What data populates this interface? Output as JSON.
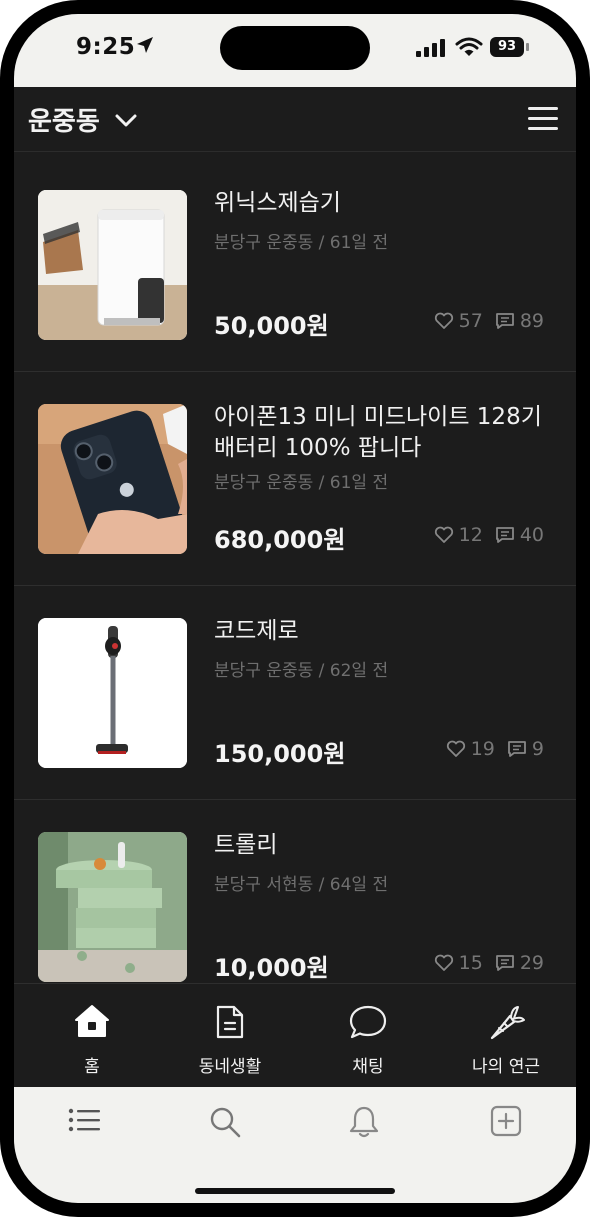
{
  "status": {
    "time": "9:25",
    "battery": "93"
  },
  "header": {
    "location": "운중동"
  },
  "items": [
    {
      "title": "위닉스제습기",
      "meta": "분당구 운중동 /  61일 전",
      "price": "50,000원",
      "likes": "57",
      "comments": "89"
    },
    {
      "title": "아이폰13 미니 미드나이트 128기 배터리 100% 팝니다",
      "meta": "분당구 운중동 /  61일 전",
      "price": "680,000원",
      "likes": "12",
      "comments": "40"
    },
    {
      "title": "코드제로",
      "meta": "분당구 운중동 /  62일 전",
      "price": "150,000원",
      "likes": "19",
      "comments": "9"
    },
    {
      "title": "트롤리",
      "meta": "분당구 서현동 /  64일 전",
      "price": "10,000원",
      "likes": "15",
      "comments": "29"
    }
  ],
  "tabs": [
    {
      "label": "홈",
      "icon": "home-icon"
    },
    {
      "label": "동네생활",
      "icon": "document-icon"
    },
    {
      "label": "채팅",
      "icon": "chat-bubble-icon"
    },
    {
      "label": "나의 연근",
      "icon": "carrot-icon"
    }
  ],
  "toolbar": {
    "icons": [
      "list-icon",
      "search-icon",
      "bell-icon",
      "add-square-icon"
    ]
  }
}
